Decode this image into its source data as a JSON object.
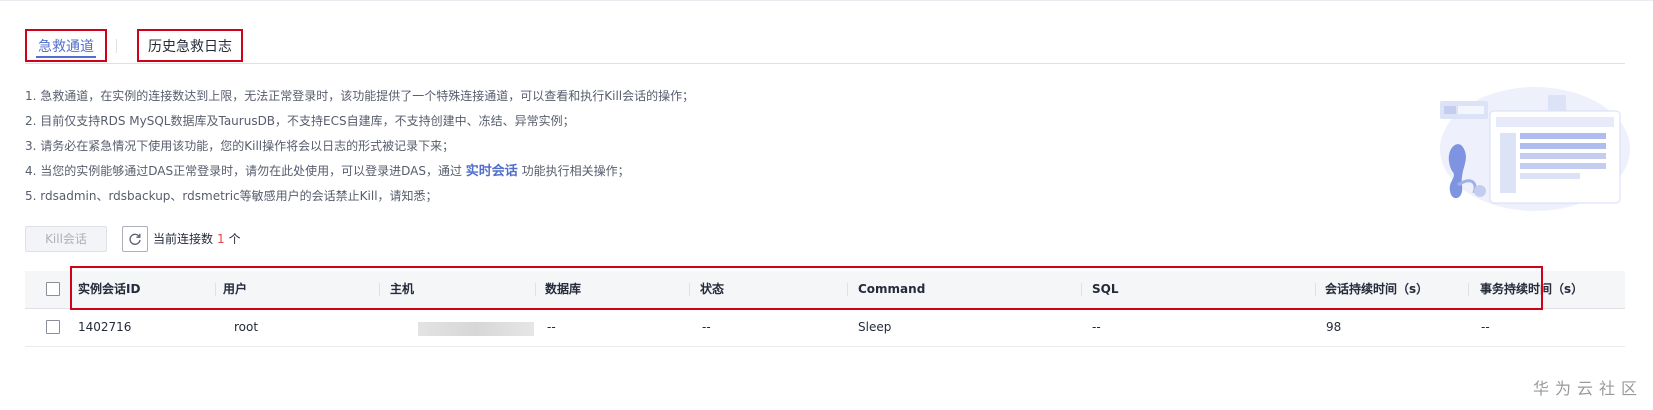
{
  "tabs": [
    {
      "label": "急救通道",
      "active": true
    },
    {
      "label": "历史急救日志",
      "active": false
    }
  ],
  "notes": [
    {
      "text": "1. 急救通道，在实例的连接数达到上限，无法正常登录时，该功能提供了一个特殊连接通道，可以查看和执行Kill会话的操作；"
    },
    {
      "text": "2. 目前仅支持RDS MySQL数据库及TaurusDB，不支持ECS自建库，不支持创建中、冻结、异常实例；"
    },
    {
      "text": "3. 请务必在紧急情况下使用该功能，您的Kill操作将会以日志的形式被记录下来；"
    },
    {
      "before": "4. 当您的实例能够通过DAS正常登录时，请勿在此处使用，可以登录进DAS，通过 ",
      "link": "实时会话",
      "after": " 功能执行相关操作；"
    },
    {
      "text": "5. rdsadmin、rdsbackup、rdsmetric等敏感用户的会话禁止Kill，请知悉；"
    }
  ],
  "toolbar": {
    "kill_label": "Kill会话",
    "refresh_icon": "refresh-icon",
    "conn_prefix": "当前连接数",
    "conn_count": "1",
    "conn_suffix": "个"
  },
  "table": {
    "columns": [
      "实例会话ID",
      "用户",
      "主机",
      "数据库",
      "状态",
      "Command",
      "SQL",
      "会话持续时间（s）",
      "事务持续时间（s）"
    ],
    "rows": [
      {
        "id": "1402716",
        "user": "root",
        "host": "",
        "db": "--",
        "state": "--",
        "command": "Sleep",
        "sql": "--",
        "session_time": "98",
        "txn_time": "--"
      }
    ]
  },
  "watermark": "华为云社区",
  "colors": {
    "accent": "#526ecc",
    "highlight_outline": "#d0021b",
    "count": "#e54545"
  }
}
